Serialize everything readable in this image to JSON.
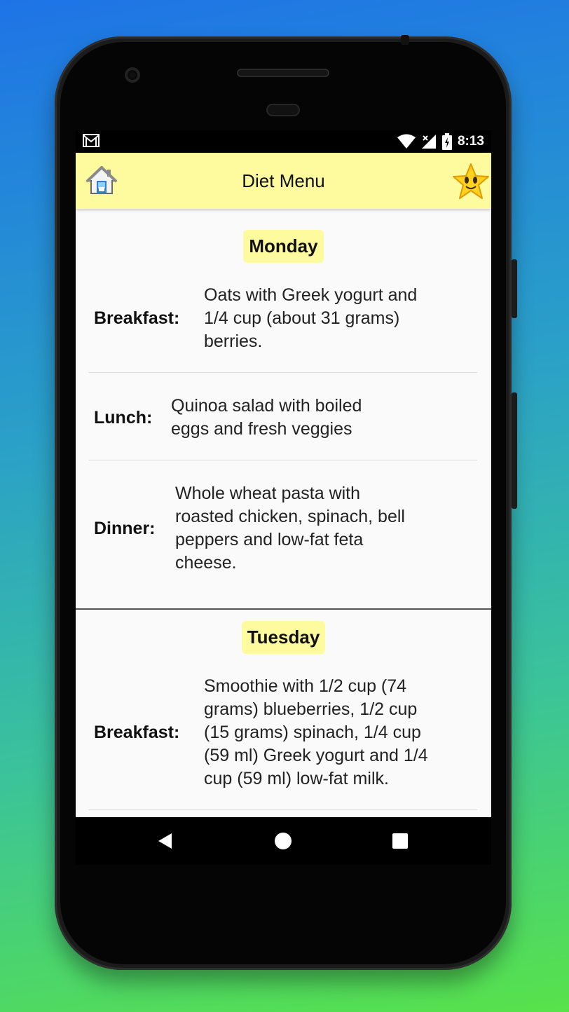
{
  "status_bar": {
    "time": "8:13",
    "icons": [
      "gmail-icon",
      "wifi-icon",
      "no-signal-icon",
      "battery-icon"
    ]
  },
  "app_bar": {
    "title": "Diet Menu",
    "left_icon": "home-icon",
    "right_icon": "star-icon",
    "background": "#fefa9e"
  },
  "days": [
    {
      "name": "Monday",
      "meals": [
        {
          "label": "Breakfast:",
          "lines": [
            "Oats with Greek yogurt and",
            "1/4 cup (about 31 grams)",
            "berries."
          ]
        },
        {
          "label": "Lunch:",
          "lines": [
            "Quinoa salad with boiled",
            "eggs and fresh veggies"
          ]
        },
        {
          "label": "Dinner:",
          "lines": [
            "Whole wheat pasta with",
            "roasted chicken, spinach, bell",
            "peppers and low-fat feta",
            "cheese."
          ]
        }
      ]
    },
    {
      "name": "Tuesday",
      "meals": [
        {
          "label": "Breakfast:",
          "lines": [
            "Smoothie with 1/2 cup (74",
            "grams) blueberries, 1/2 cup",
            "(15 grams) spinach, 1/4 cup",
            "(59 ml) Greek yogurt and 1/4",
            "cup (59 ml) low-fat milk."
          ]
        }
      ]
    }
  ],
  "nav_bar": {
    "icons": [
      "back-icon",
      "home-circle-icon",
      "recents-icon"
    ]
  }
}
